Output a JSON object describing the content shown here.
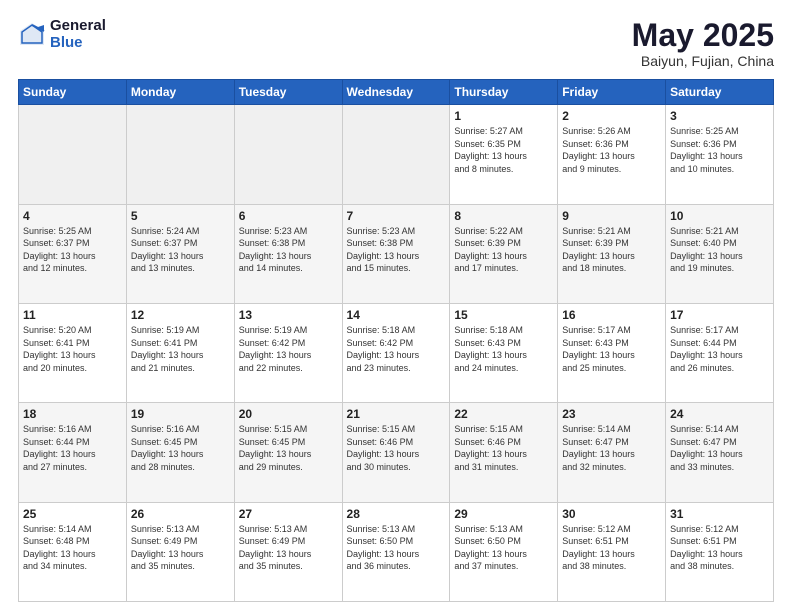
{
  "header": {
    "logo_general": "General",
    "logo_blue": "Blue",
    "month_title": "May 2025",
    "subtitle": "Baiyun, Fujian, China"
  },
  "days_of_week": [
    "Sunday",
    "Monday",
    "Tuesday",
    "Wednesday",
    "Thursday",
    "Friday",
    "Saturday"
  ],
  "weeks": [
    [
      {
        "num": "",
        "info": ""
      },
      {
        "num": "",
        "info": ""
      },
      {
        "num": "",
        "info": ""
      },
      {
        "num": "",
        "info": ""
      },
      {
        "num": "1",
        "info": "Sunrise: 5:27 AM\nSunset: 6:35 PM\nDaylight: 13 hours\nand 8 minutes."
      },
      {
        "num": "2",
        "info": "Sunrise: 5:26 AM\nSunset: 6:36 PM\nDaylight: 13 hours\nand 9 minutes."
      },
      {
        "num": "3",
        "info": "Sunrise: 5:25 AM\nSunset: 6:36 PM\nDaylight: 13 hours\nand 10 minutes."
      }
    ],
    [
      {
        "num": "4",
        "info": "Sunrise: 5:25 AM\nSunset: 6:37 PM\nDaylight: 13 hours\nand 12 minutes."
      },
      {
        "num": "5",
        "info": "Sunrise: 5:24 AM\nSunset: 6:37 PM\nDaylight: 13 hours\nand 13 minutes."
      },
      {
        "num": "6",
        "info": "Sunrise: 5:23 AM\nSunset: 6:38 PM\nDaylight: 13 hours\nand 14 minutes."
      },
      {
        "num": "7",
        "info": "Sunrise: 5:23 AM\nSunset: 6:38 PM\nDaylight: 13 hours\nand 15 minutes."
      },
      {
        "num": "8",
        "info": "Sunrise: 5:22 AM\nSunset: 6:39 PM\nDaylight: 13 hours\nand 17 minutes."
      },
      {
        "num": "9",
        "info": "Sunrise: 5:21 AM\nSunset: 6:39 PM\nDaylight: 13 hours\nand 18 minutes."
      },
      {
        "num": "10",
        "info": "Sunrise: 5:21 AM\nSunset: 6:40 PM\nDaylight: 13 hours\nand 19 minutes."
      }
    ],
    [
      {
        "num": "11",
        "info": "Sunrise: 5:20 AM\nSunset: 6:41 PM\nDaylight: 13 hours\nand 20 minutes."
      },
      {
        "num": "12",
        "info": "Sunrise: 5:19 AM\nSunset: 6:41 PM\nDaylight: 13 hours\nand 21 minutes."
      },
      {
        "num": "13",
        "info": "Sunrise: 5:19 AM\nSunset: 6:42 PM\nDaylight: 13 hours\nand 22 minutes."
      },
      {
        "num": "14",
        "info": "Sunrise: 5:18 AM\nSunset: 6:42 PM\nDaylight: 13 hours\nand 23 minutes."
      },
      {
        "num": "15",
        "info": "Sunrise: 5:18 AM\nSunset: 6:43 PM\nDaylight: 13 hours\nand 24 minutes."
      },
      {
        "num": "16",
        "info": "Sunrise: 5:17 AM\nSunset: 6:43 PM\nDaylight: 13 hours\nand 25 minutes."
      },
      {
        "num": "17",
        "info": "Sunrise: 5:17 AM\nSunset: 6:44 PM\nDaylight: 13 hours\nand 26 minutes."
      }
    ],
    [
      {
        "num": "18",
        "info": "Sunrise: 5:16 AM\nSunset: 6:44 PM\nDaylight: 13 hours\nand 27 minutes."
      },
      {
        "num": "19",
        "info": "Sunrise: 5:16 AM\nSunset: 6:45 PM\nDaylight: 13 hours\nand 28 minutes."
      },
      {
        "num": "20",
        "info": "Sunrise: 5:15 AM\nSunset: 6:45 PM\nDaylight: 13 hours\nand 29 minutes."
      },
      {
        "num": "21",
        "info": "Sunrise: 5:15 AM\nSunset: 6:46 PM\nDaylight: 13 hours\nand 30 minutes."
      },
      {
        "num": "22",
        "info": "Sunrise: 5:15 AM\nSunset: 6:46 PM\nDaylight: 13 hours\nand 31 minutes."
      },
      {
        "num": "23",
        "info": "Sunrise: 5:14 AM\nSunset: 6:47 PM\nDaylight: 13 hours\nand 32 minutes."
      },
      {
        "num": "24",
        "info": "Sunrise: 5:14 AM\nSunset: 6:47 PM\nDaylight: 13 hours\nand 33 minutes."
      }
    ],
    [
      {
        "num": "25",
        "info": "Sunrise: 5:14 AM\nSunset: 6:48 PM\nDaylight: 13 hours\nand 34 minutes."
      },
      {
        "num": "26",
        "info": "Sunrise: 5:13 AM\nSunset: 6:49 PM\nDaylight: 13 hours\nand 35 minutes."
      },
      {
        "num": "27",
        "info": "Sunrise: 5:13 AM\nSunset: 6:49 PM\nDaylight: 13 hours\nand 35 minutes."
      },
      {
        "num": "28",
        "info": "Sunrise: 5:13 AM\nSunset: 6:50 PM\nDaylight: 13 hours\nand 36 minutes."
      },
      {
        "num": "29",
        "info": "Sunrise: 5:13 AM\nSunset: 6:50 PM\nDaylight: 13 hours\nand 37 minutes."
      },
      {
        "num": "30",
        "info": "Sunrise: 5:12 AM\nSunset: 6:51 PM\nDaylight: 13 hours\nand 38 minutes."
      },
      {
        "num": "31",
        "info": "Sunrise: 5:12 AM\nSunset: 6:51 PM\nDaylight: 13 hours\nand 38 minutes."
      }
    ]
  ]
}
